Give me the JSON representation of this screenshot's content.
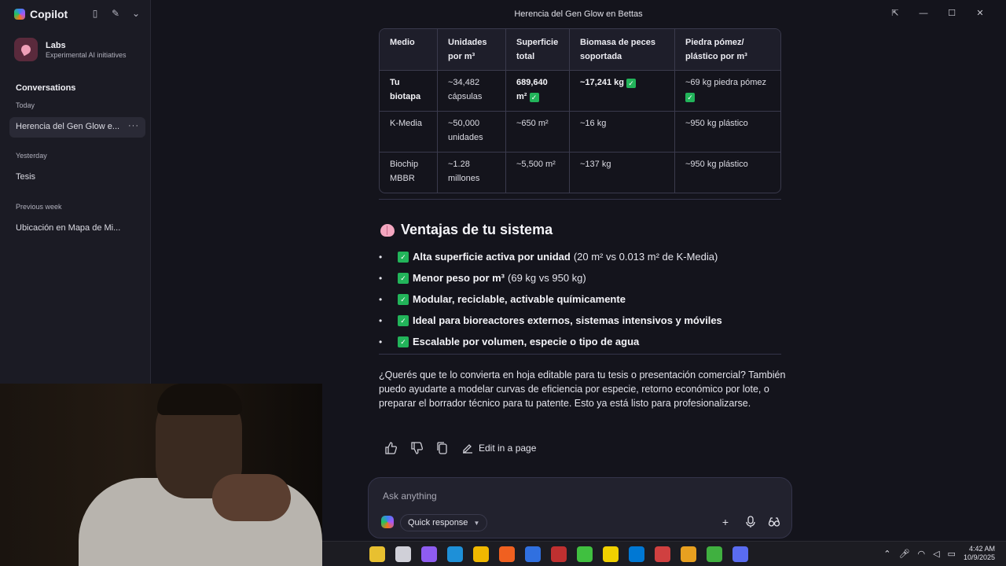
{
  "app": {
    "brand": "Copilot",
    "window_title": "Herencia del Gen Glow en Bettas"
  },
  "sidebar": {
    "labs_title": "Labs",
    "labs_subtitle": "Experimental AI initiatives",
    "conversations_title": "Conversations",
    "groups": [
      {
        "label": "Today",
        "items": [
          "Herencia del Gen Glow e..."
        ]
      },
      {
        "label": "Yesterday",
        "items": [
          "Tesis"
        ]
      },
      {
        "label": "Previous week",
        "items": [
          "Ubicación en Mapa de Mi..."
        ]
      }
    ],
    "more_label": "···"
  },
  "table": {
    "headers": [
      "Medio",
      "Unidades por m³",
      "Superficie total",
      "Biomasa de peces soportada",
      "Piedra pómez/ plástico por m³"
    ],
    "rows": [
      {
        "medio": "Tu biotapa",
        "unidades": "~34,482 cápsulas",
        "superficie": "689,640 m²",
        "biomasa": "~17,241 kg",
        "piedra": "~69 kg piedra pómez"
      },
      {
        "medio": "K-Media",
        "unidades": "~50,000 unidades",
        "superficie": "~650 m²",
        "biomasa": "~16 kg",
        "piedra": "~950 kg plástico"
      },
      {
        "medio": "Biochip MBBR",
        "unidades": "~1.28 millones",
        "superficie": "~5,500 m²",
        "biomasa": "~137 kg",
        "piedra": "~950 kg plástico"
      }
    ],
    "check_glyph": "✓"
  },
  "section": {
    "heading": "Ventajas de tu sistema",
    "bullets": [
      {
        "bold": "Alta superficie activa por unidad",
        "rest": "(20 m² vs 0.013 m² de K-Media)"
      },
      {
        "bold": "Menor peso por m³",
        "rest": "(69 kg vs 950 kg)"
      },
      {
        "bold": "Modular, reciclable, activable químicamente",
        "rest": ""
      },
      {
        "bold": "Ideal para bioreactores externos, sistemas intensivos y móviles",
        "rest": ""
      },
      {
        "bold": "Escalable por volumen, especie o tipo de agua",
        "rest": ""
      }
    ],
    "paragraph": "¿Querés que te lo convierta en hoja editable para tu tesis o presentación comercial? También puedo ayudarte a modelar curvas de eficiencia por especie, retorno económico por lote, o preparar el borrador técnico para tu patente. Esto ya está listo para profesionalizarse."
  },
  "actions": {
    "edit_label": "Edit in a page"
  },
  "composer": {
    "placeholder": "Ask anything",
    "mode_label": "Quick response"
  },
  "taskbar": {
    "time": "4:42 AM",
    "date": "10/9/2025",
    "icon_colors": [
      "#e8c030",
      "#d0d0d8",
      "#8e5cf0",
      "#1e90d8",
      "#f0b800",
      "#f06020",
      "#3070e0",
      "#c03030",
      "#40c040",
      "#f0d000",
      "#0078d4",
      "#d04040",
      "#e8a020",
      "#40b040",
      "#5a6cf0"
    ]
  }
}
